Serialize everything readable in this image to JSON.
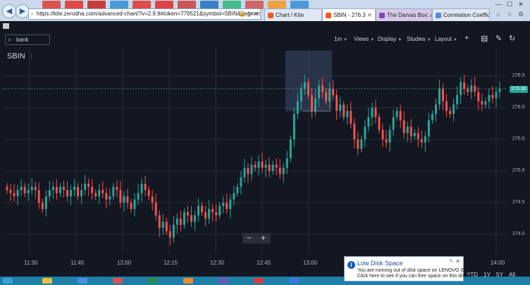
{
  "browser": {
    "url": "https://kite.zerodha.com/advanced-chart/?v=2.9.9#token=779521&symbol=SBIN&segment=NSE",
    "tabs": [
      {
        "label": "Chart / Kite",
        "active": false,
        "color": "#dfe8f3"
      },
      {
        "label": "SBIN - 276.3",
        "active": true,
        "color": "#ffffff"
      },
      {
        "label": "The Darvas Box: A T...",
        "active": false,
        "color": "#d8c8e8"
      },
      {
        "label": "Correlation Coeffici...",
        "active": false,
        "color": "#dfe8f3"
      }
    ]
  },
  "toolbar": {
    "search_value": "bank",
    "interval": "1m",
    "views": "Views",
    "display": "Display",
    "studies": "Studies",
    "layout": "Layout"
  },
  "chart": {
    "symbol": "SBIN",
    "current_price_label": "276.30",
    "colors": {
      "up": "#26a69a",
      "down": "#ef5350",
      "background": "#131722",
      "grid": "#2a2e39"
    }
  },
  "chart_data": {
    "type": "candlestick",
    "title": "SBIN",
    "interval": "1m",
    "price_ticks": [
      "276.5",
      "276.0",
      "275.5",
      "275.0",
      "274.5",
      "274.0"
    ],
    "time_ticks": [
      "11:30",
      "11:45",
      "12:00",
      "12:15",
      "12:30",
      "12:45",
      "13:00",
      "14:00"
    ],
    "ylim": [
      273.8,
      276.8
    ],
    "current_price": 276.3,
    "grid": true,
    "candles": [
      [
        274.75,
        274.7
      ],
      [
        274.7,
        274.65
      ],
      [
        274.65,
        274.6
      ],
      [
        274.6,
        274.7
      ],
      [
        274.7,
        274.75
      ],
      [
        274.75,
        274.65
      ],
      [
        274.65,
        274.7
      ],
      [
        274.7,
        274.75
      ],
      [
        274.75,
        274.7
      ],
      [
        274.7,
        274.5
      ],
      [
        274.5,
        274.4
      ],
      [
        274.4,
        274.6
      ],
      [
        274.6,
        274.7
      ],
      [
        274.7,
        274.75
      ],
      [
        274.75,
        274.65
      ],
      [
        274.65,
        274.75
      ],
      [
        274.75,
        274.7
      ],
      [
        274.7,
        274.6
      ],
      [
        274.6,
        274.7
      ],
      [
        274.7,
        274.75
      ],
      [
        274.75,
        274.6
      ],
      [
        274.6,
        274.7
      ],
      [
        274.7,
        274.8
      ],
      [
        274.8,
        274.75
      ],
      [
        274.75,
        274.65
      ],
      [
        274.65,
        274.6
      ],
      [
        274.6,
        274.7
      ],
      [
        274.7,
        274.65
      ],
      [
        274.65,
        274.55
      ],
      [
        274.55,
        274.6
      ],
      [
        274.6,
        274.75
      ],
      [
        274.75,
        274.7
      ],
      [
        274.7,
        274.5
      ],
      [
        274.5,
        274.6
      ],
      [
        274.6,
        274.5
      ],
      [
        274.5,
        274.4
      ],
      [
        274.4,
        274.55
      ],
      [
        274.55,
        274.65
      ],
      [
        274.65,
        274.8
      ],
      [
        274.8,
        274.7
      ],
      [
        274.7,
        274.6
      ],
      [
        274.6,
        274.5
      ],
      [
        274.5,
        274.3
      ],
      [
        274.3,
        274.1
      ],
      [
        274.1,
        274.2
      ],
      [
        274.2,
        274.05
      ],
      [
        274.05,
        273.95
      ],
      [
        273.95,
        274.15
      ],
      [
        274.15,
        274.25
      ],
      [
        274.25,
        274.15
      ],
      [
        274.15,
        274.35
      ],
      [
        274.35,
        274.3
      ],
      [
        274.3,
        274.2
      ],
      [
        274.2,
        274.3
      ],
      [
        274.3,
        274.45
      ],
      [
        274.45,
        274.35
      ],
      [
        274.35,
        274.25
      ],
      [
        274.25,
        274.4
      ],
      [
        274.4,
        274.35
      ],
      [
        274.35,
        274.3
      ],
      [
        274.3,
        274.45
      ],
      [
        274.45,
        274.5
      ],
      [
        274.5,
        274.4
      ],
      [
        274.4,
        274.55
      ],
      [
        274.55,
        274.65
      ],
      [
        274.65,
        274.75
      ],
      [
        274.75,
        274.9
      ],
      [
        274.9,
        275.05
      ],
      [
        275.05,
        274.95
      ],
      [
        274.95,
        275.1
      ],
      [
        275.1,
        275.05
      ],
      [
        275.05,
        275.15
      ],
      [
        275.15,
        275.05
      ],
      [
        275.05,
        275.1
      ],
      [
        275.1,
        275.0
      ],
      [
        275.0,
        275.1
      ],
      [
        275.1,
        275.05
      ],
      [
        275.05,
        274.95
      ],
      [
        274.95,
        275.05
      ],
      [
        275.05,
        275.2
      ],
      [
        275.2,
        275.5
      ],
      [
        275.5,
        275.9
      ],
      [
        275.9,
        276.1
      ],
      [
        276.1,
        276.3
      ],
      [
        276.3,
        276.4
      ],
      [
        276.4,
        276.2
      ],
      [
        276.2,
        275.95
      ],
      [
        275.95,
        276.15
      ],
      [
        276.15,
        276.35
      ],
      [
        276.35,
        276.25
      ],
      [
        276.25,
        276.1
      ],
      [
        276.1,
        276.3
      ],
      [
        276.3,
        276.2
      ],
      [
        276.2,
        275.95
      ],
      [
        275.95,
        276.05
      ],
      [
        276.05,
        275.85
      ],
      [
        275.85,
        275.95
      ],
      [
        275.95,
        275.75
      ],
      [
        275.75,
        275.5
      ],
      [
        275.5,
        275.35
      ],
      [
        275.35,
        275.5
      ],
      [
        275.5,
        275.7
      ],
      [
        275.7,
        275.85
      ],
      [
        275.85,
        276.0
      ],
      [
        276.0,
        275.85
      ],
      [
        275.85,
        275.65
      ],
      [
        275.65,
        275.5
      ],
      [
        275.5,
        275.45
      ],
      [
        275.45,
        275.65
      ],
      [
        275.65,
        275.85
      ],
      [
        275.85,
        275.95
      ],
      [
        275.95,
        275.8
      ],
      [
        275.8,
        275.6
      ],
      [
        275.6,
        275.7
      ],
      [
        275.7,
        275.55
      ],
      [
        275.55,
        275.6
      ],
      [
        275.6,
        275.5
      ],
      [
        275.5,
        275.45
      ],
      [
        275.45,
        275.55
      ],
      [
        275.55,
        275.8
      ],
      [
        275.8,
        275.9
      ],
      [
        275.9,
        276.05
      ],
      [
        276.05,
        276.3
      ],
      [
        276.3,
        276.1
      ],
      [
        276.1,
        275.95
      ],
      [
        275.95,
        275.9
      ],
      [
        275.9,
        276.05
      ],
      [
        276.05,
        276.2
      ],
      [
        276.2,
        276.4
      ],
      [
        276.4,
        276.3
      ],
      [
        276.3,
        276.25
      ],
      [
        276.25,
        276.35
      ],
      [
        276.35,
        276.25
      ],
      [
        276.25,
        276.1
      ],
      [
        276.1,
        276.05
      ],
      [
        276.05,
        276.1
      ],
      [
        276.1,
        276.2
      ],
      [
        276.2,
        276.15
      ],
      [
        276.15,
        276.25
      ],
      [
        276.25,
        276.3
      ]
    ]
  },
  "zoom": {
    "minus": "−",
    "plus": "+"
  },
  "range_buttons": [
    "YTD",
    "1Y",
    "5Y",
    "All"
  ],
  "notification": {
    "title": "Low Disk Space",
    "line1": "You are running out of disk space on LENOVO (D:).",
    "line2": "Click here to see if you can free space on this drive."
  }
}
